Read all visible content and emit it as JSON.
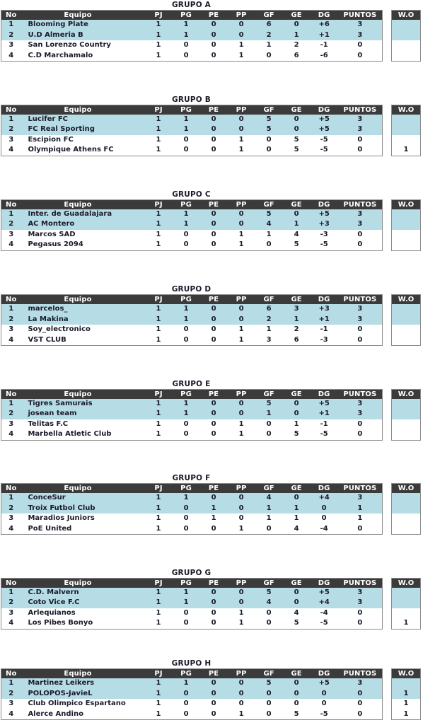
{
  "page": {
    "background_color": "#ffffff",
    "header_color": "#3b3b3b",
    "qualified_row_color": "#b6dce6",
    "normal_row_color": "#ffffff",
    "text_color": "#1b1b2b",
    "border_color": "#8a8a8a"
  },
  "columns": {
    "no": "No",
    "team": "Equipo",
    "pj": "PJ",
    "pg": "PG",
    "pe": "PE",
    "pp": "PP",
    "gf": "GF",
    "ge": "GE",
    "dg": "DG",
    "puntos": "PUNTOS",
    "wo": "W.O"
  },
  "groups": [
    {
      "title": "GRUPO A",
      "rows": [
        {
          "no": "1",
          "team": "Blooming Plate",
          "pj": "1",
          "pg": "1",
          "pe": "0",
          "pp": "0",
          "gf": "6",
          "ge": "0",
          "dg": "+6",
          "puntos": "3",
          "wo": "",
          "qualified": true
        },
        {
          "no": "2",
          "team": "U.D Almeria B",
          "pj": "1",
          "pg": "1",
          "pe": "0",
          "pp": "0",
          "gf": "2",
          "ge": "1",
          "dg": "+1",
          "puntos": "3",
          "wo": "",
          "qualified": true
        },
        {
          "no": "3",
          "team": "San Lorenzo Country",
          "pj": "1",
          "pg": "0",
          "pe": "0",
          "pp": "1",
          "gf": "1",
          "ge": "2",
          "dg": "-1",
          "puntos": "0",
          "wo": "",
          "qualified": false
        },
        {
          "no": "4",
          "team": "C.D Marchamalo",
          "pj": "1",
          "pg": "0",
          "pe": "0",
          "pp": "1",
          "gf": "0",
          "ge": "6",
          "dg": "-6",
          "puntos": "0",
          "wo": "",
          "qualified": false
        }
      ]
    },
    {
      "title": "GRUPO B",
      "rows": [
        {
          "no": "1",
          "team": "Lucifer FC",
          "pj": "1",
          "pg": "1",
          "pe": "0",
          "pp": "0",
          "gf": "5",
          "ge": "0",
          "dg": "+5",
          "puntos": "3",
          "wo": "",
          "qualified": true
        },
        {
          "no": "2",
          "team": "FC Real Sporting",
          "pj": "1",
          "pg": "1",
          "pe": "0",
          "pp": "0",
          "gf": "5",
          "ge": "0",
          "dg": "+5",
          "puntos": "3",
          "wo": "",
          "qualified": true
        },
        {
          "no": "3",
          "team": "Escipion FC",
          "pj": "1",
          "pg": "0",
          "pe": "0",
          "pp": "1",
          "gf": "0",
          "ge": "5",
          "dg": "-5",
          "puntos": "0",
          "wo": "",
          "qualified": false
        },
        {
          "no": "4",
          "team": "Olympique Athens FC",
          "pj": "1",
          "pg": "0",
          "pe": "0",
          "pp": "1",
          "gf": "0",
          "ge": "5",
          "dg": "-5",
          "puntos": "0",
          "wo": "1",
          "qualified": false
        }
      ]
    },
    {
      "title": "GRUPO C",
      "rows": [
        {
          "no": "1",
          "team": "Inter.  de Guadalajara",
          "pj": "1",
          "pg": "1",
          "pe": "0",
          "pp": "0",
          "gf": "5",
          "ge": "0",
          "dg": "+5",
          "puntos": "3",
          "wo": "",
          "qualified": true
        },
        {
          "no": "2",
          "team": "AC Montero",
          "pj": "1",
          "pg": "1",
          "pe": "0",
          "pp": "0",
          "gf": "4",
          "ge": "1",
          "dg": "+3",
          "puntos": "3",
          "wo": "",
          "qualified": true
        },
        {
          "no": "3",
          "team": "Marcos SAD",
          "pj": "1",
          "pg": "0",
          "pe": "0",
          "pp": "1",
          "gf": "1",
          "ge": "4",
          "dg": "-3",
          "puntos": "0",
          "wo": "",
          "qualified": false
        },
        {
          "no": "4",
          "team": "Pegasus 2094",
          "pj": "1",
          "pg": "0",
          "pe": "0",
          "pp": "1",
          "gf": "0",
          "ge": "5",
          "dg": "-5",
          "puntos": "0",
          "wo": "",
          "qualified": false
        }
      ]
    },
    {
      "title": "GRUPO D",
      "rows": [
        {
          "no": "1",
          "team": "marcelos_",
          "pj": "1",
          "pg": "1",
          "pe": "0",
          "pp": "0",
          "gf": "6",
          "ge": "3",
          "dg": "+3",
          "puntos": "3",
          "wo": "",
          "qualified": true
        },
        {
          "no": "2",
          "team": "La Makina",
          "pj": "1",
          "pg": "1",
          "pe": "0",
          "pp": "0",
          "gf": "2",
          "ge": "1",
          "dg": "+1",
          "puntos": "3",
          "wo": "",
          "qualified": true
        },
        {
          "no": "3",
          "team": "Soy_electronico",
          "pj": "1",
          "pg": "0",
          "pe": "0",
          "pp": "1",
          "gf": "1",
          "ge": "2",
          "dg": "-1",
          "puntos": "0",
          "wo": "",
          "qualified": false
        },
        {
          "no": "4",
          "team": "VST CLUB",
          "pj": "1",
          "pg": "0",
          "pe": "0",
          "pp": "1",
          "gf": "3",
          "ge": "6",
          "dg": "-3",
          "puntos": "0",
          "wo": "",
          "qualified": false
        }
      ]
    },
    {
      "title": "GRUPO E",
      "rows": [
        {
          "no": "1",
          "team": "Tigres Samurais",
          "pj": "1",
          "pg": "1",
          "pe": "0",
          "pp": "0",
          "gf": "5",
          "ge": "0",
          "dg": "+5",
          "puntos": "3",
          "wo": "",
          "qualified": true
        },
        {
          "no": "2",
          "team": "josean team",
          "pj": "1",
          "pg": "1",
          "pe": "0",
          "pp": "0",
          "gf": "1",
          "ge": "0",
          "dg": "+1",
          "puntos": "3",
          "wo": "",
          "qualified": true
        },
        {
          "no": "3",
          "team": "Telitas F.C",
          "pj": "1",
          "pg": "0",
          "pe": "0",
          "pp": "1",
          "gf": "0",
          "ge": "1",
          "dg": "-1",
          "puntos": "0",
          "wo": "",
          "qualified": false
        },
        {
          "no": "4",
          "team": "Marbella Atletic Club",
          "pj": "1",
          "pg": "0",
          "pe": "0",
          "pp": "1",
          "gf": "0",
          "ge": "5",
          "dg": "-5",
          "puntos": "0",
          "wo": "",
          "qualified": false
        }
      ]
    },
    {
      "title": "GRUPO F",
      "rows": [
        {
          "no": "1",
          "team": "ConceSur",
          "pj": "1",
          "pg": "1",
          "pe": "0",
          "pp": "0",
          "gf": "4",
          "ge": "0",
          "dg": "+4",
          "puntos": "3",
          "wo": "",
          "qualified": true
        },
        {
          "no": "2",
          "team": "Troix Futbol Club",
          "pj": "1",
          "pg": "0",
          "pe": "1",
          "pp": "0",
          "gf": "1",
          "ge": "1",
          "dg": "0",
          "puntos": "1",
          "wo": "",
          "qualified": true
        },
        {
          "no": "3",
          "team": "Maradios Juniors",
          "pj": "1",
          "pg": "0",
          "pe": "1",
          "pp": "0",
          "gf": "1",
          "ge": "1",
          "dg": "0",
          "puntos": "1",
          "wo": "",
          "qualified": false
        },
        {
          "no": "4",
          "team": "PoE United",
          "pj": "1",
          "pg": "0",
          "pe": "0",
          "pp": "1",
          "gf": "0",
          "ge": "4",
          "dg": "-4",
          "puntos": "0",
          "wo": "",
          "qualified": false
        }
      ]
    },
    {
      "title": "GRUPO G",
      "rows": [
        {
          "no": "1",
          "team": "C.D. Malvern",
          "pj": "1",
          "pg": "1",
          "pe": "0",
          "pp": "0",
          "gf": "5",
          "ge": "0",
          "dg": "+5",
          "puntos": "3",
          "wo": "",
          "qualified": true
        },
        {
          "no": "2",
          "team": "Coto Vice F.C",
          "pj": "1",
          "pg": "1",
          "pe": "0",
          "pp": "0",
          "gf": "4",
          "ge": "0",
          "dg": "+4",
          "puntos": "3",
          "wo": "",
          "qualified": true
        },
        {
          "no": "3",
          "team": "Arlequianos",
          "pj": "1",
          "pg": "0",
          "pe": "0",
          "pp": "1",
          "gf": "0",
          "ge": "4",
          "dg": "-4",
          "puntos": "0",
          "wo": "",
          "qualified": false
        },
        {
          "no": "4",
          "team": "Los Pibes Bonyo",
          "pj": "1",
          "pg": "0",
          "pe": "0",
          "pp": "1",
          "gf": "0",
          "ge": "5",
          "dg": "-5",
          "puntos": "0",
          "wo": "1",
          "qualified": false
        }
      ]
    },
    {
      "title": "GRUPO H",
      "rows": [
        {
          "no": "1",
          "team": "Martinez Leikers",
          "pj": "1",
          "pg": "1",
          "pe": "0",
          "pp": "0",
          "gf": "5",
          "ge": "0",
          "dg": "+5",
          "puntos": "3",
          "wo": "",
          "qualified": true
        },
        {
          "no": "2",
          "team": "POLOPOS-JavieL",
          "pj": "1",
          "pg": "0",
          "pe": "0",
          "pp": "0",
          "gf": "0",
          "ge": "0",
          "dg": "0",
          "puntos": "0",
          "wo": "1",
          "qualified": true
        },
        {
          "no": "3",
          "team": "Club Olimpico Espartano",
          "pj": "1",
          "pg": "0",
          "pe": "0",
          "pp": "0",
          "gf": "0",
          "ge": "0",
          "dg": "0",
          "puntos": "0",
          "wo": "1",
          "qualified": false
        },
        {
          "no": "4",
          "team": "Alerce Andino",
          "pj": "1",
          "pg": "0",
          "pe": "0",
          "pp": "1",
          "gf": "0",
          "ge": "5",
          "dg": "-5",
          "puntos": "0",
          "wo": "1",
          "qualified": false
        }
      ]
    }
  ]
}
